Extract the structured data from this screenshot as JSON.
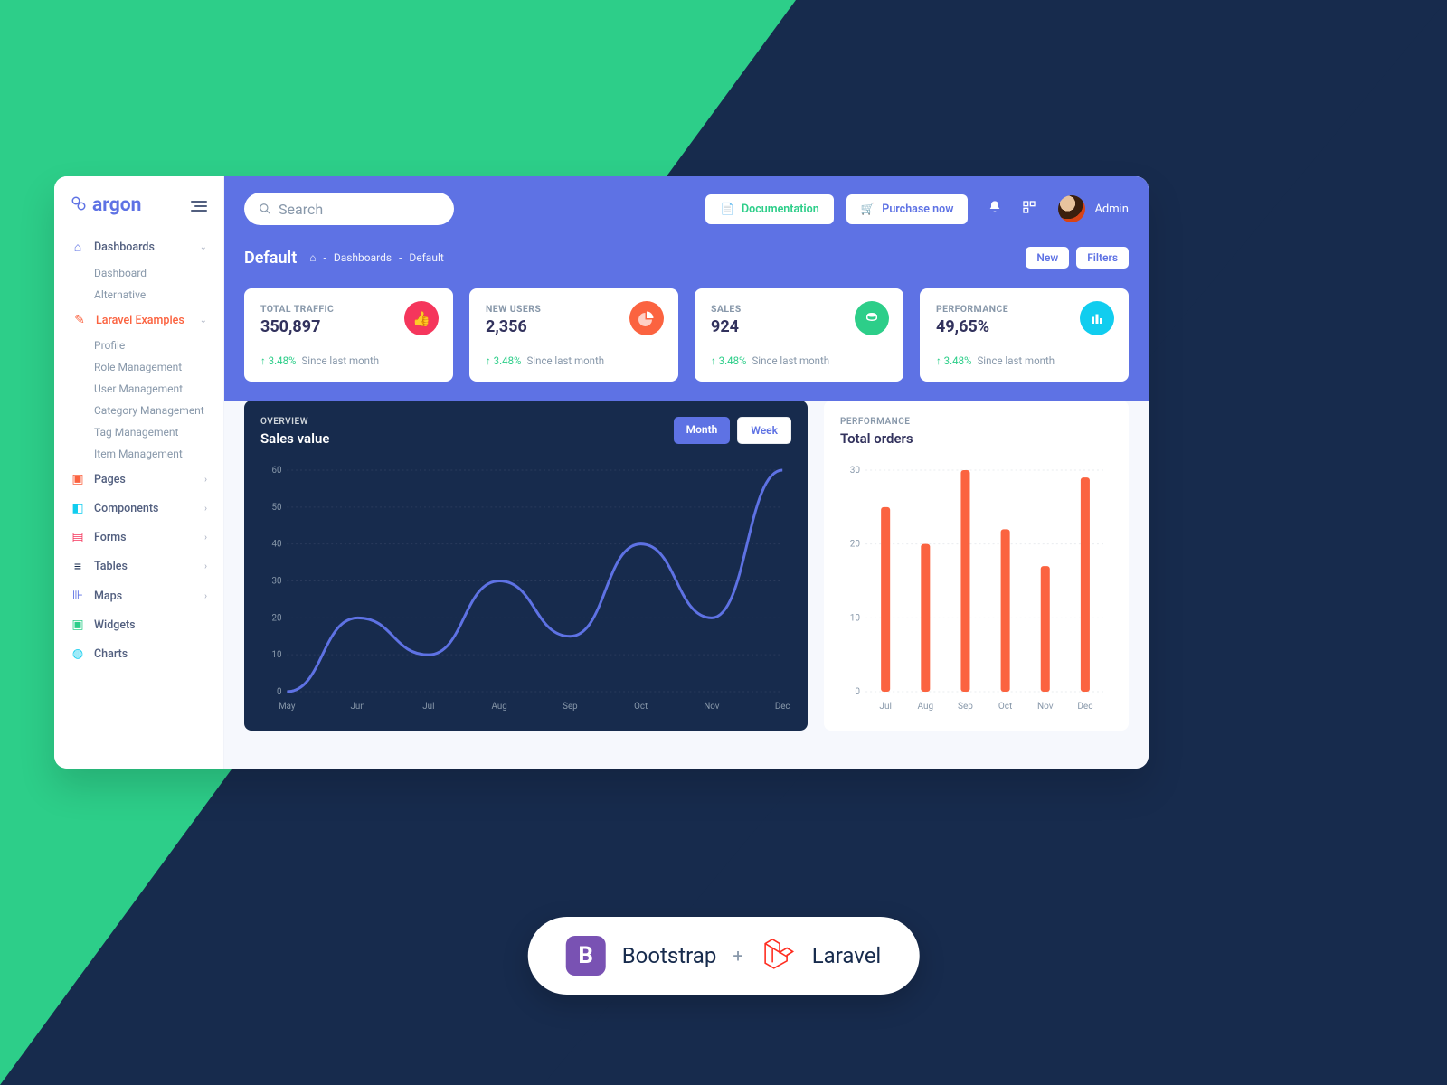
{
  "brand": "argon",
  "search": {
    "placeholder": "Search"
  },
  "header": {
    "doc_btn": "Documentation",
    "buy_btn": "Purchase now",
    "user": "Admin"
  },
  "breadcrumb": {
    "title": "Default",
    "trail": [
      "Dashboards",
      "Default"
    ],
    "new_btn": "New",
    "filters_btn": "Filters"
  },
  "sidebar": {
    "dashboards": {
      "label": "Dashboards",
      "items": [
        "Dashboard",
        "Alternative"
      ]
    },
    "laravel": {
      "label": "Laravel Examples",
      "items": [
        "Profile",
        "Role Management",
        "User Management",
        "Category Management",
        "Tag Management",
        "Item Management"
      ]
    },
    "pages": "Pages",
    "components": "Components",
    "forms": "Forms",
    "tables": "Tables",
    "maps": "Maps",
    "widgets": "Widgets",
    "charts": "Charts"
  },
  "cards": [
    {
      "label": "TOTAL TRAFFIC",
      "value": "350,897",
      "delta": "3.48%",
      "since": "Since last month"
    },
    {
      "label": "NEW USERS",
      "value": "2,356",
      "delta": "3.48%",
      "since": "Since last month"
    },
    {
      "label": "SALES",
      "value": "924",
      "delta": "3.48%",
      "since": "Since last month"
    },
    {
      "label": "PERFORMANCE",
      "value": "49,65%",
      "delta": "3.48%",
      "since": "Since last month"
    }
  ],
  "sales_panel": {
    "over": "OVERVIEW",
    "title": "Sales value",
    "tab_month": "Month",
    "tab_week": "Week"
  },
  "orders_panel": {
    "over": "PERFORMANCE",
    "title": "Total orders"
  },
  "footer": {
    "bootstrap": "Bootstrap",
    "laravel": "Laravel",
    "b_letter": "B"
  },
  "chart_data": [
    {
      "type": "line",
      "title": "Sales value",
      "xlabel": "",
      "ylabel": "",
      "ylim": [
        0,
        60
      ],
      "categories": [
        "May",
        "Jun",
        "Jul",
        "Aug",
        "Sep",
        "Oct",
        "Nov",
        "Dec"
      ],
      "values": [
        0,
        20,
        10,
        30,
        15,
        40,
        20,
        60
      ]
    },
    {
      "type": "bar",
      "title": "Total orders",
      "xlabel": "",
      "ylabel": "",
      "ylim": [
        0,
        30
      ],
      "categories": [
        "Jul",
        "Aug",
        "Sep",
        "Oct",
        "Nov",
        "Dec"
      ],
      "values": [
        25,
        20,
        30,
        22,
        17,
        29
      ]
    }
  ]
}
